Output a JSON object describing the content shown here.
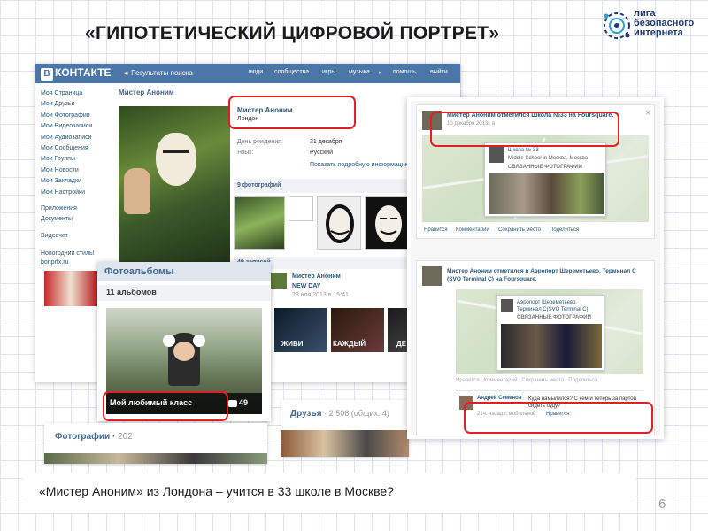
{
  "slide": {
    "title": "«ГИПОТЕТИЧЕСКИЙ ЦИФРОВОЙ ПОРТРЕТ»",
    "logo_lines": [
      "лига",
      "безопасного",
      "интернета"
    ],
    "caption": "«Мистер Аноним» из Лондона – учится в 33 школе в Москве?",
    "page_number": "6"
  },
  "vk": {
    "logo_letter": "B",
    "logo_text": "КОНТАКТЕ",
    "breadcrumb": "◄ Результаты поиска",
    "nav": [
      "люди",
      "сообщества",
      "игры",
      "музыка",
      "помощь",
      "выйти"
    ],
    "sidebar_items": [
      "Моя Страница",
      "Мои Друзья",
      "Мои Фотографии",
      "Мои Видеозаписи",
      "Мои Аудиозаписи",
      "Мои Сообщения",
      "Мои Группы",
      "Мои Новости",
      "Мои Закладки",
      "Мои Настройки"
    ],
    "sidebar_extra": [
      "Приложения",
      "Документы"
    ],
    "sidebar_extra2": [
      "Видеочат"
    ],
    "promo": "Новогодний стиль! bonprfx.ru",
    "profile_name": "Мистер Аноним",
    "info_name": "Мистер Аноним",
    "info_city": "Лондон",
    "birthday_label": "День рождения:",
    "birthday_value": "31 декабря",
    "language_label": "Язык:",
    "language_value": "Русский",
    "more_info": "Показать подробную информацию",
    "photos_title": "9 фотографий",
    "wall_title": "49 записей",
    "wall_author": "Мистер Аноним",
    "wall_post": "NEW DAY",
    "wall_date": "28 ноя 2013 в 15:41",
    "wall_labels": [
      "ЖИВИ",
      "КАЖДЫЙ",
      "ДЕ"
    ]
  },
  "albums": {
    "title": "Фотоальбомы",
    "count": "11 альбомов",
    "album_name": "Мой любимый класс",
    "album_photos": "49"
  },
  "photos_strip": {
    "title": "Фотографии",
    "count": "202"
  },
  "friends_strip": {
    "title": "Друзья",
    "count": "2 506 (общих: 4)"
  },
  "fsq": {
    "post1_text": "Мистер Аноним отметился Школа №33 на Foursquare.",
    "post1_date": "10 декабря 2013г. в",
    "venue1_name": "Школа № 33",
    "venue1_addr": "Middle School in Москва, Москва",
    "venue1_sub": "СВЯЗАННЫЕ ФОТОГРАФИИ",
    "post1_actions": [
      "Нравится",
      "Комментарий",
      "Сохранить место",
      "Поделиться"
    ],
    "post2_text_line1": "Мистер Аноним отметился в  Аэропорт Шереметьево, Терминал С",
    "post2_text_line2": "(SVO  Terminal C) на Foursquare.",
    "venue2_name": "Аэропорт Шереметьево, Терминал С(SVO Terminal C)",
    "venue2_sub": "СВЯЗАННЫЕ ФОТОГРАФИИ",
    "post2_actions": [
      "Нравится",
      "Комментарий",
      "Сохранить место",
      "Поделиться"
    ],
    "comment_author": "Андрей Семенов",
    "comment_text": "Куда намылился? С кем и теперь за партой сидеть буду?",
    "comment_meta": "21ч. назад с мобильной",
    "comment_like": "Нравится"
  },
  "colors": {
    "vk_header": "#4a76a8",
    "vk_link": "#2b587a",
    "highlight": "#e31e24"
  }
}
